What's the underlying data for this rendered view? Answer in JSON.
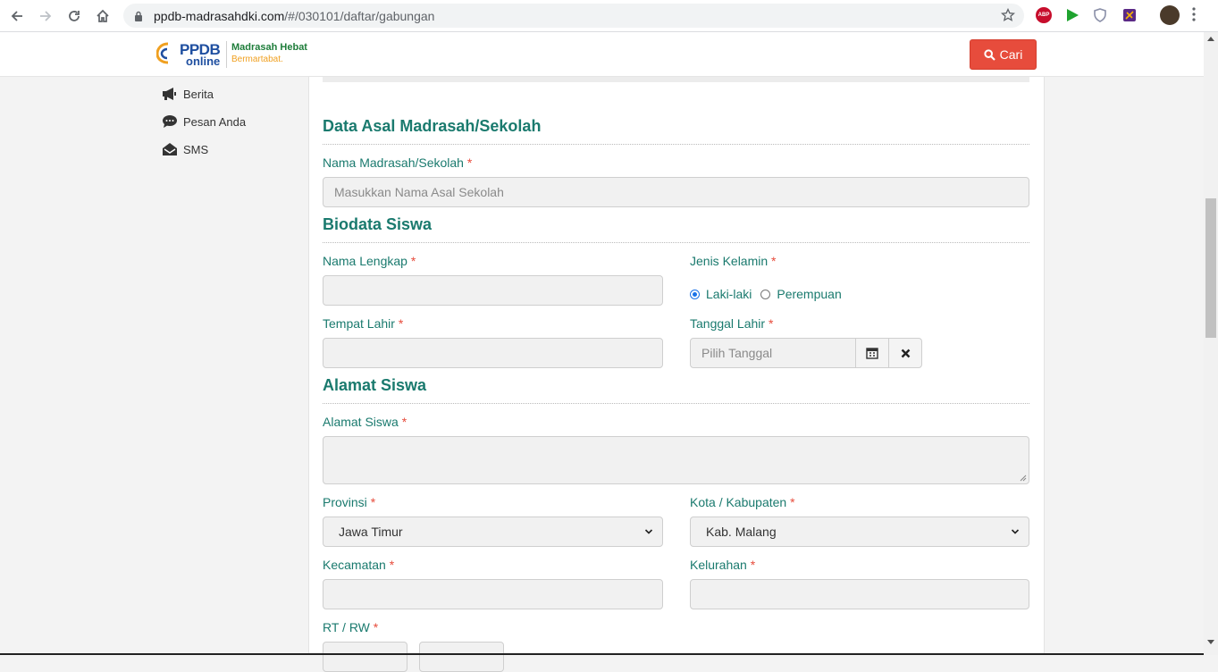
{
  "browser": {
    "url_host": "ppdb-madrasahdki.com",
    "url_path": "/#/030101/daftar/gabungan",
    "icons": [
      "back-icon",
      "forward-icon",
      "reload-icon",
      "home-icon",
      "lock-icon",
      "bookmark-star-icon",
      "adblock-icon",
      "play-extension-icon",
      "shield-extension-icon",
      "extension-icon",
      "profile-avatar",
      "menu-icon"
    ],
    "abp_label": "ABP"
  },
  "header": {
    "logo_ppdb": "PPDB",
    "logo_online": "online",
    "tagline_1": "Madrasah Hebat",
    "tagline_2": "Bermartabat.",
    "search_button": "Cari",
    "accent_color": "#e74c3c"
  },
  "sidebar": {
    "items": [
      {
        "label": "Berita",
        "icon": "megaphone-icon"
      },
      {
        "label": "Pesan Anda",
        "icon": "comment-icon"
      },
      {
        "label": "SMS",
        "icon": "envelope-open-icon"
      }
    ]
  },
  "form": {
    "primary_color": "#1a7a6e",
    "required_mark": "*",
    "section_school": "Data Asal Madrasah/Sekolah",
    "school_name_label": "Nama Madrasah/Sekolah",
    "school_name_placeholder": "Masukkan Nama Asal Sekolah",
    "section_biodata": "Biodata Siswa",
    "full_name_label": "Nama Lengkap",
    "gender_label": "Jenis Kelamin",
    "gender_options": [
      {
        "label": "Laki-laki",
        "selected": true
      },
      {
        "label": "Perempuan",
        "selected": false
      }
    ],
    "birthplace_label": "Tempat Lahir",
    "birthdate_label": "Tanggal Lahir",
    "birthdate_placeholder": "Pilih Tanggal",
    "section_address": "Alamat Siswa",
    "address_label": "Alamat Siswa",
    "province_label": "Provinsi",
    "province_value": "Jawa Timur",
    "city_label": "Kota / Kabupaten",
    "city_value": "Kab. Malang",
    "district_label": "Kecamatan",
    "village_label": "Kelurahan",
    "rtrw_label": "RT / RW"
  }
}
